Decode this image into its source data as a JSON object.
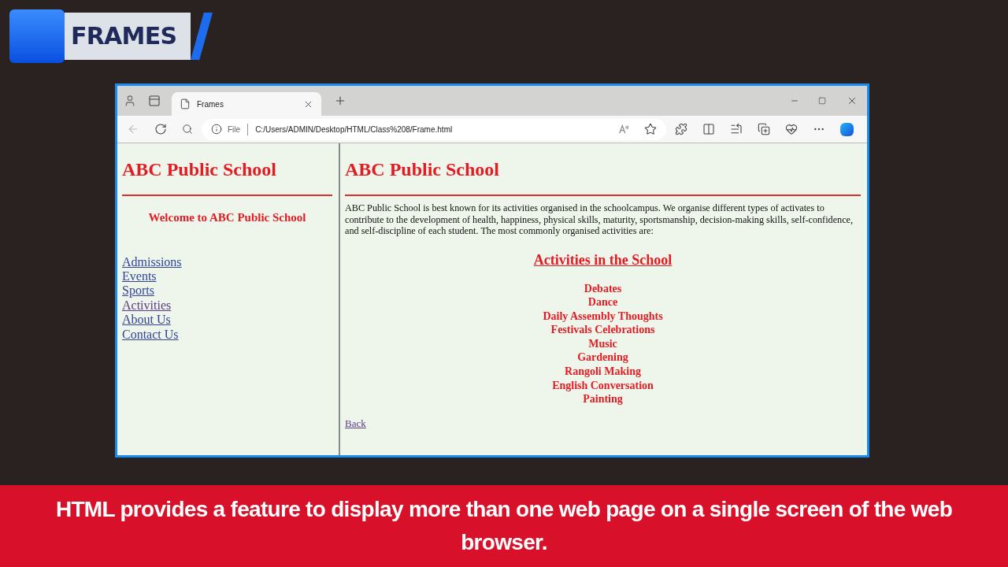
{
  "banner": {
    "title": "FRAMES"
  },
  "browser": {
    "tab": {
      "title": "Frames",
      "selected": true
    },
    "address": {
      "scheme": "File",
      "url": "C:/Users/ADMIN/Desktop/HTML/Class%208/Frame.html"
    }
  },
  "left_frame": {
    "heading": "ABC Public School",
    "welcome": "Welcome to ABC Public School",
    "links": [
      {
        "label": "Admissions",
        "visited": false
      },
      {
        "label": "Events",
        "visited": false
      },
      {
        "label": "Sports",
        "visited": false
      },
      {
        "label": "Activities",
        "visited": true
      },
      {
        "label": "About Us",
        "visited": false
      },
      {
        "label": "Contact Us",
        "visited": false
      }
    ]
  },
  "right_frame": {
    "heading": "ABC Public School",
    "paragraph": "ABC Public School is best known for its activities organised in the schoolcampus. We organise different types of activates to contribute to the development of health, happiness, physical skills, maturity, sportsmanship, decision-making skills, self-confidence, and self-discipline of each student. The most commonly organised activities are:",
    "subheading": "Activities in the School",
    "activities": [
      "Debates",
      "Dance",
      "Daily Assembly Thoughts",
      "Festivals Celebrations",
      "Music",
      "Gardening",
      "Rangoli Making",
      "English Conversation",
      "Painting"
    ],
    "back_link": {
      "label": "Back",
      "visited": true
    }
  },
  "caption": "HTML provides a feature to display more than one web page on a single screen of the web browser."
}
